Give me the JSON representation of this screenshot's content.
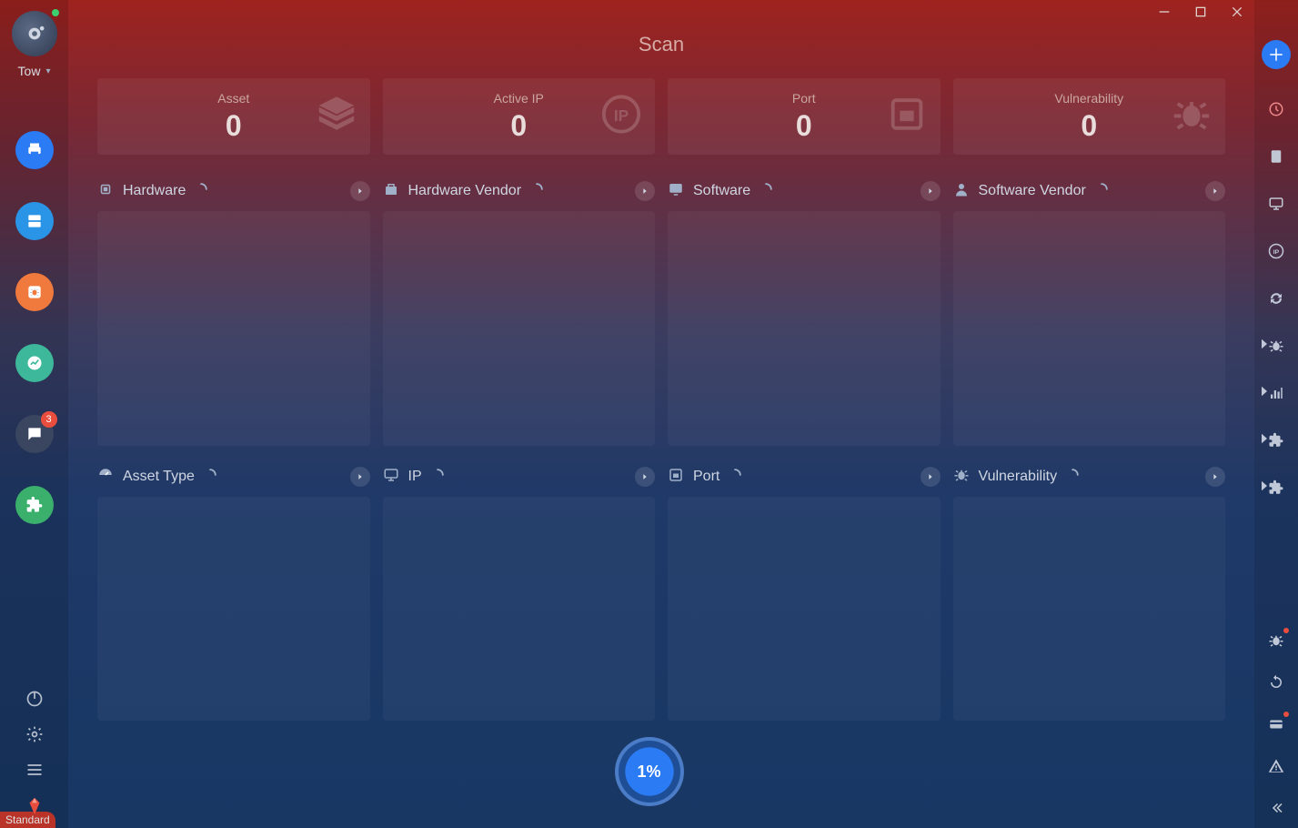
{
  "sidebar_left": {
    "workspace_label": "Tow",
    "chat_badge": "3",
    "standard_tag": "Standard"
  },
  "page": {
    "title": "Scan"
  },
  "stats": [
    {
      "label": "Asset",
      "value": "0",
      "icon": "layers"
    },
    {
      "label": "Active IP",
      "value": "0",
      "icon": "ip"
    },
    {
      "label": "Port",
      "value": "0",
      "icon": "port"
    },
    {
      "label": "Vulnerability",
      "value": "0",
      "icon": "bug"
    }
  ],
  "panels_row1": [
    {
      "title": "Hardware",
      "icon": "cpu"
    },
    {
      "title": "Hardware Vendor",
      "icon": "vendor"
    },
    {
      "title": "Software",
      "icon": "software"
    },
    {
      "title": "Software Vendor",
      "icon": "person"
    }
  ],
  "panels_row2": [
    {
      "title": "Asset Type",
      "icon": "meter"
    },
    {
      "title": "IP",
      "icon": "monitor"
    },
    {
      "title": "Port",
      "icon": "port"
    },
    {
      "title": "Vulnerability",
      "icon": "bug"
    }
  ],
  "progress": {
    "label": "1%"
  },
  "colors": {
    "accent": "#2a7bf4",
    "danger": "#e84d3d"
  }
}
